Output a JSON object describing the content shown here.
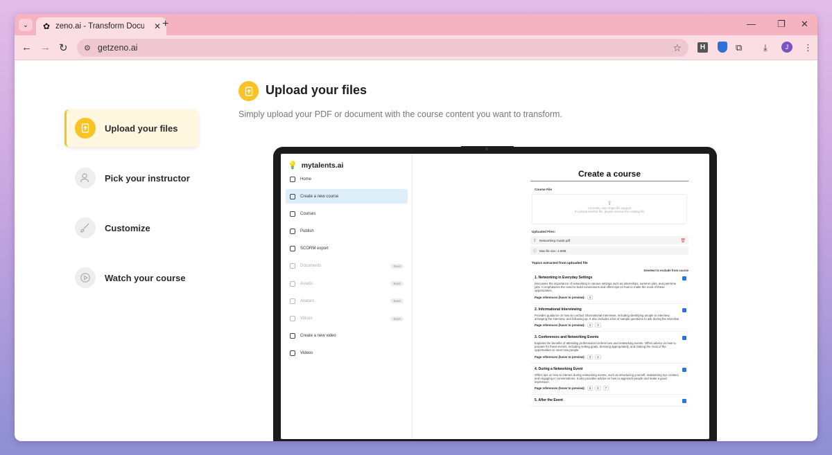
{
  "browser": {
    "tab_title": "zeno.ai - Transform Documents",
    "url": "getzeno.ai",
    "profile_initial": "J",
    "extension_letter": "H"
  },
  "steps": [
    {
      "label": "Upload your files",
      "icon": "upload-icon",
      "active": true
    },
    {
      "label": "Pick your instructor",
      "icon": "user-icon",
      "active": false
    },
    {
      "label": "Customize",
      "icon": "brush-icon",
      "active": false
    },
    {
      "label": "Watch your course",
      "icon": "play-icon",
      "active": false
    }
  ],
  "hero": {
    "title": "Upload your files",
    "subtitle": "Simply upload your PDF or document with the course content you want to transform."
  },
  "app": {
    "logo": "mytalents.ai",
    "nav": [
      {
        "label": "Home"
      },
      {
        "label": "Create a new course"
      },
      {
        "label": "Courses"
      },
      {
        "label": "Publish"
      },
      {
        "label": "SCORM export"
      },
      {
        "label": "Documents",
        "badge": "Soon"
      },
      {
        "label": "Assets",
        "badge": "Soon"
      },
      {
        "label": "Avatars",
        "badge": "Soon"
      },
      {
        "label": "Voices",
        "badge": "Soon"
      },
      {
        "label": "Create a new video"
      },
      {
        "label": "Videos"
      }
    ],
    "main": {
      "title": "Create a course",
      "course_file_label": "Course File",
      "dropzone_line1": "Currently, only single-file support",
      "dropzone_line2": "To upload another file, please remove the existing file",
      "uploaded_label": "Uploaded Files:",
      "file_name": "Networking Guide.pdf",
      "max_size": "Max file size: 4.5MB",
      "topics_title": "Topics extracted from uploaded file",
      "deselect_label": "Deselect to exclude from course",
      "page_ref_label": "Page references (hover to preview):",
      "topics": [
        {
          "title": "1.  Networking in Everyday Settings",
          "desc": "Discusses the importance of networking in various settings such as internships, summer jobs, and part-time jobs. It emphasizes the need to build connections and offers tips on how to make the most of these opportunities.",
          "refs": [
            "2"
          ]
        },
        {
          "title": "2.  Informational Interviewing",
          "desc": "Provides guidance on how to conduct informational interviews, including identifying people to interview, arranging the interview, and following up. It also includes a list of sample questions to ask during the interview.",
          "refs": [
            "2",
            "3"
          ]
        },
        {
          "title": "3.  Conferences and Networking Events",
          "desc": "Explains the benefits of attending professional conferences and networking events. Offers advice on how to prepare for these events, including setting goals, dressing appropriately, and making the most of the opportunities to meet new people.",
          "refs": [
            "3",
            "4"
          ]
        },
        {
          "title": "4.  During a Networking Event",
          "desc": "Offers tips on how to interact during networking events, such as introducing yourself, maintaining eye contact, and engaging in conversations. It also provides advice on how to approach people and make a good impression.",
          "refs": [
            "5",
            "6",
            "7"
          ]
        },
        {
          "title": "5.  After the Event",
          "desc": "",
          "refs": []
        }
      ]
    }
  }
}
